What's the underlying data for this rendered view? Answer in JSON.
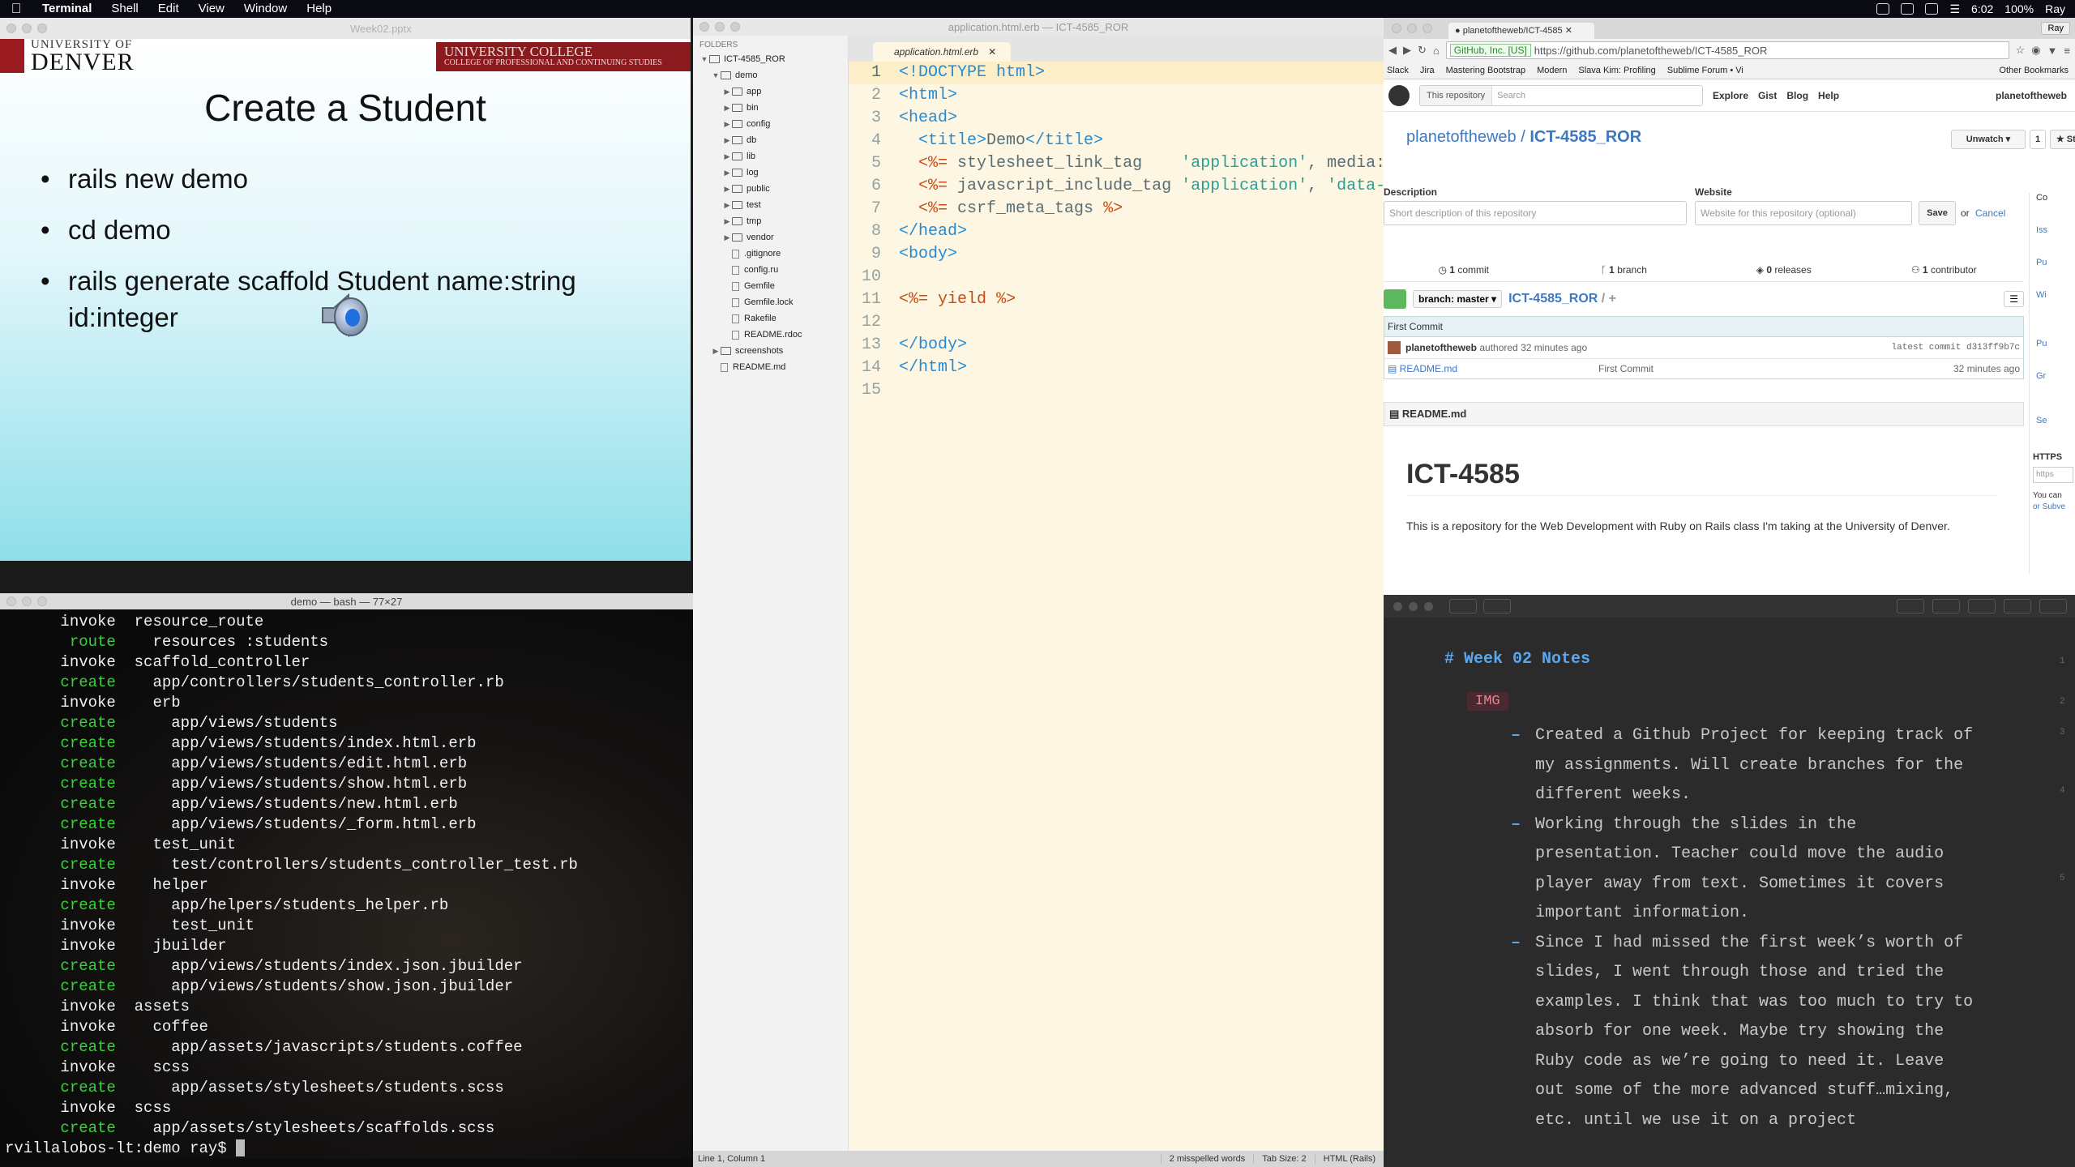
{
  "menubar": {
    "app": "Terminal",
    "items": [
      "Shell",
      "Edit",
      "View",
      "Window",
      "Help"
    ],
    "time": "6:02",
    "battery": "100%",
    "user": "Ray"
  },
  "ppt": {
    "window_title": "Week02.pptx",
    "logo_top": "UNIVERSITY OF",
    "logo_main": "DENVER",
    "banner_a": "UNIVERSITY COLLEGE",
    "banner_b": "COLLEGE OF PROFESSIONAL AND CONTINUING STUDIES",
    "title": "Create a Student",
    "bullets": [
      "rails new demo",
      "cd demo",
      "rails generate scaffold Student name:string id:integer"
    ]
  },
  "terminal": {
    "title": "demo — bash — 77×27",
    "lines": [
      {
        "verb": "invoke",
        "indent": "  ",
        "text": "resource_route",
        "color": "w"
      },
      {
        "verb": "route",
        "indent": "    ",
        "text": "resources :students",
        "color": "g",
        "pad": " "
      },
      {
        "verb": "invoke",
        "indent": "  ",
        "text": "scaffold_controller",
        "color": "w"
      },
      {
        "verb": "create",
        "indent": "    ",
        "text": "app/controllers/students_controller.rb",
        "color": "g"
      },
      {
        "verb": "invoke",
        "indent": "    ",
        "text": "erb",
        "color": "w"
      },
      {
        "verb": "create",
        "indent": "      ",
        "text": "app/views/students",
        "color": "g"
      },
      {
        "verb": "create",
        "indent": "      ",
        "text": "app/views/students/index.html.erb",
        "color": "g"
      },
      {
        "verb": "create",
        "indent": "      ",
        "text": "app/views/students/edit.html.erb",
        "color": "g"
      },
      {
        "verb": "create",
        "indent": "      ",
        "text": "app/views/students/show.html.erb",
        "color": "g"
      },
      {
        "verb": "create",
        "indent": "      ",
        "text": "app/views/students/new.html.erb",
        "color": "g"
      },
      {
        "verb": "create",
        "indent": "      ",
        "text": "app/views/students/_form.html.erb",
        "color": "g"
      },
      {
        "verb": "invoke",
        "indent": "    ",
        "text": "test_unit",
        "color": "w"
      },
      {
        "verb": "create",
        "indent": "      ",
        "text": "test/controllers/students_controller_test.rb",
        "color": "g"
      },
      {
        "verb": "invoke",
        "indent": "    ",
        "text": "helper",
        "color": "w"
      },
      {
        "verb": "create",
        "indent": "      ",
        "text": "app/helpers/students_helper.rb",
        "color": "g"
      },
      {
        "verb": "invoke",
        "indent": "      ",
        "text": "test_unit",
        "color": "w"
      },
      {
        "verb": "invoke",
        "indent": "    ",
        "text": "jbuilder",
        "color": "w"
      },
      {
        "verb": "create",
        "indent": "      ",
        "text": "app/views/students/index.json.jbuilder",
        "color": "g"
      },
      {
        "verb": "create",
        "indent": "      ",
        "text": "app/views/students/show.json.jbuilder",
        "color": "g"
      },
      {
        "verb": "invoke",
        "indent": "  ",
        "text": "assets",
        "color": "w"
      },
      {
        "verb": "invoke",
        "indent": "    ",
        "text": "coffee",
        "color": "w"
      },
      {
        "verb": "create",
        "indent": "      ",
        "text": "app/assets/javascripts/students.coffee",
        "color": "g"
      },
      {
        "verb": "invoke",
        "indent": "    ",
        "text": "scss",
        "color": "w"
      },
      {
        "verb": "create",
        "indent": "      ",
        "text": "app/assets/stylesheets/students.scss",
        "color": "g"
      },
      {
        "verb": "invoke",
        "indent": "  ",
        "text": "scss",
        "color": "w"
      },
      {
        "verb": "create",
        "indent": "    ",
        "text": "app/assets/stylesheets/scaffolds.scss",
        "color": "g"
      }
    ],
    "prompt": "rvillalobos-lt:demo ray$ "
  },
  "sublime": {
    "window_title": "application.html.erb — ICT-4585_ROR",
    "folders_header": "FOLDERS",
    "tree": [
      {
        "name": "ICT-4585_ROR",
        "type": "folder",
        "open": true,
        "depth": 0
      },
      {
        "name": "demo",
        "type": "folder",
        "open": true,
        "depth": 1
      },
      {
        "name": "app",
        "type": "folder",
        "open": false,
        "depth": 2
      },
      {
        "name": "bin",
        "type": "folder",
        "open": false,
        "depth": 2
      },
      {
        "name": "config",
        "type": "folder",
        "open": false,
        "depth": 2
      },
      {
        "name": "db",
        "type": "folder",
        "open": false,
        "depth": 2
      },
      {
        "name": "lib",
        "type": "folder",
        "open": false,
        "depth": 2
      },
      {
        "name": "log",
        "type": "folder",
        "open": false,
        "depth": 2
      },
      {
        "name": "public",
        "type": "folder",
        "open": false,
        "depth": 2
      },
      {
        "name": "test",
        "type": "folder",
        "open": false,
        "depth": 2
      },
      {
        "name": "tmp",
        "type": "folder",
        "open": false,
        "depth": 2
      },
      {
        "name": "vendor",
        "type": "folder",
        "open": false,
        "depth": 2
      },
      {
        "name": ".gitignore",
        "type": "file",
        "depth": 2
      },
      {
        "name": "config.ru",
        "type": "file",
        "depth": 2
      },
      {
        "name": "Gemfile",
        "type": "file",
        "depth": 2
      },
      {
        "name": "Gemfile.lock",
        "type": "file",
        "depth": 2
      },
      {
        "name": "Rakefile",
        "type": "file",
        "depth": 2
      },
      {
        "name": "README.rdoc",
        "type": "file",
        "depth": 2
      },
      {
        "name": "screenshots",
        "type": "folder",
        "open": false,
        "depth": 1
      },
      {
        "name": "README.md",
        "type": "file",
        "depth": 1
      }
    ],
    "tab": "application.html.erb",
    "code_lines": [
      "<span class=\"kw\">&lt;!DOCTYPE html&gt;</span>",
      "<span class=\"kw\">&lt;html&gt;</span>",
      "<span class=\"kw\">&lt;head&gt;</span>",
      "  <span class=\"kw\">&lt;title&gt;</span>Demo<span class=\"kw\">&lt;/title&gt;</span>",
      "  <span class=\"erb\">&lt;%=</span> stylesheet_link_tag    <span class=\"str\">'application'</span>, media:",
      "  <span class=\"erb\">&lt;%=</span> javascript_include_tag <span class=\"str\">'application'</span>, <span class=\"str\">'data-</span>",
      "  <span class=\"erb\">&lt;%=</span> csrf_meta_tags <span class=\"erb\">%&gt;</span>",
      "<span class=\"kw\">&lt;/head&gt;</span>",
      "<span class=\"kw\">&lt;body&gt;</span>",
      "",
      "<span class=\"erb\">&lt;%=</span> <span class=\"erb\">yield</span> <span class=\"erb\">%&gt;</span>",
      "",
      "<span class=\"kw\">&lt;/body&gt;</span>",
      "<span class=\"kw\">&lt;/html&gt;</span>",
      ""
    ],
    "status_left": "Line 1, Column 1",
    "status_right": [
      "2 misspelled words",
      "Tab Size: 2",
      "HTML (Rails)"
    ]
  },
  "chrome": {
    "tab_title": "planetoftheweb/ICT-4585",
    "user_button": "Ray",
    "ev_label": "GitHub, Inc. [US]",
    "url": "https://github.com/planetoftheweb/ICT-4585_ROR",
    "bookmarks": [
      "Slack",
      "Jira",
      "Mastering Bootstrap",
      "Modern",
      "Slava Kim: Profiling",
      "Sublime Forum • Vi"
    ],
    "other_bookmarks": "Other Bookmarks"
  },
  "github": {
    "scope": "This repository",
    "search_placeholder": "Search",
    "nav": [
      "Explore",
      "Gist",
      "Blog",
      "Help"
    ],
    "username": "planetoftheweb",
    "repo_owner": "planetoftheweb",
    "repo_sep": " / ",
    "repo_name": "ICT-4585_ROR",
    "unwatch": "Unwatch ▾",
    "watch_count": "1",
    "star": "★ Star",
    "desc_label": "Description",
    "desc_placeholder": "Short description of this repository",
    "website_label": "Website",
    "website_placeholder": "Website for this repository (optional)",
    "save": "Save",
    "or": "or",
    "cancel": "Cancel",
    "stats": [
      {
        "n": "1",
        "label": "commit"
      },
      {
        "n": "1",
        "label": "branch"
      },
      {
        "n": "0",
        "label": "releases"
      },
      {
        "n": "1",
        "label": "contributor"
      }
    ],
    "branch_label": "branch:",
    "branch": "master ▾",
    "path": "ICT-4585_ROR",
    "path_plus": " / +",
    "commit_msg": "First Commit",
    "commit_author": "planetoftheweb",
    "commit_when": "authored 32 minutes ago",
    "latest_commit_label": "latest commit",
    "latest_commit": "d313ff9b7c",
    "file_name": "README.md",
    "file_msg": "First Commit",
    "file_age": "32 minutes ago",
    "readme_header": "README.md",
    "readme_h1": "ICT-4585",
    "readme_text": "This is a repository for the Web Development with Ruby on Rails class I'm taking at the University of Denver.",
    "rail": [
      "Co",
      "Iss",
      "Pu",
      "Wi",
      "Pu",
      "Gr",
      "Se",
      "HTTPS",
      "https",
      "You can",
      "or Subve"
    ]
  },
  "markdown": {
    "heading": "# Week 02 Notes",
    "img_tag": "IMG",
    "items": [
      "Created a Github Project for keeping track of my assignments. Will create branches for the different weeks.",
      "Working through the slides in the presentation. Teacher could move the audio player away from text. Sometimes it covers important information.",
      "Since I had missed the first week’s worth of slides, I went through those and tried the examples. I think that was too much to try to absorb for one week. Maybe try showing the Ruby code as we’re going to need it. Leave out some of the more advanced stuff…mixing, etc. until we use it on a project"
    ],
    "gutter": [
      "1",
      "2",
      "3",
      "4",
      "5"
    ]
  }
}
